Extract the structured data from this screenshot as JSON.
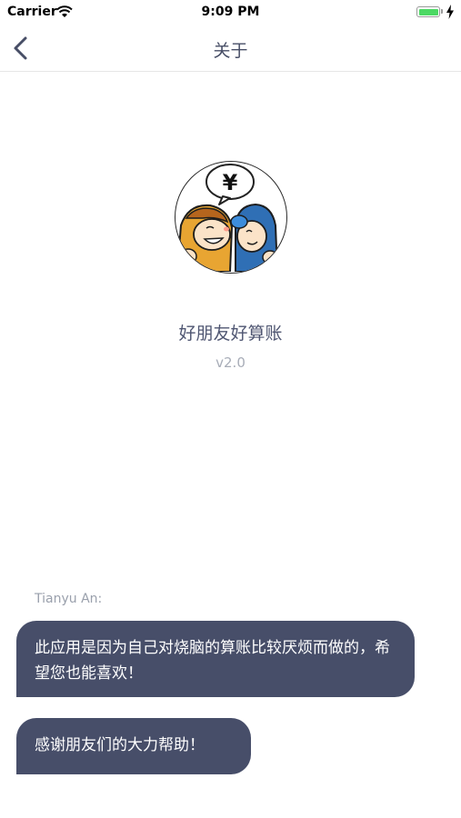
{
  "status_bar": {
    "carrier": "Carrier",
    "time": "9:09 PM",
    "battery_color": "#4cd964"
  },
  "nav": {
    "title": "关于",
    "back_icon": "chevron-left-icon"
  },
  "app": {
    "name": "好朋友好算账",
    "version": "v2.0",
    "logo_currency_symbol": "¥"
  },
  "chat": {
    "author": "Tianyu An:",
    "messages": [
      {
        "text": "此应用是因为自己对烧脑的算账比较厌烦而做的，希望您也能喜欢！"
      },
      {
        "text": "感谢朋友们的大力帮助！"
      }
    ],
    "bubble_color": "#474e69"
  },
  "colors": {
    "accent": "#474e66",
    "muted": "#a8adb8"
  }
}
